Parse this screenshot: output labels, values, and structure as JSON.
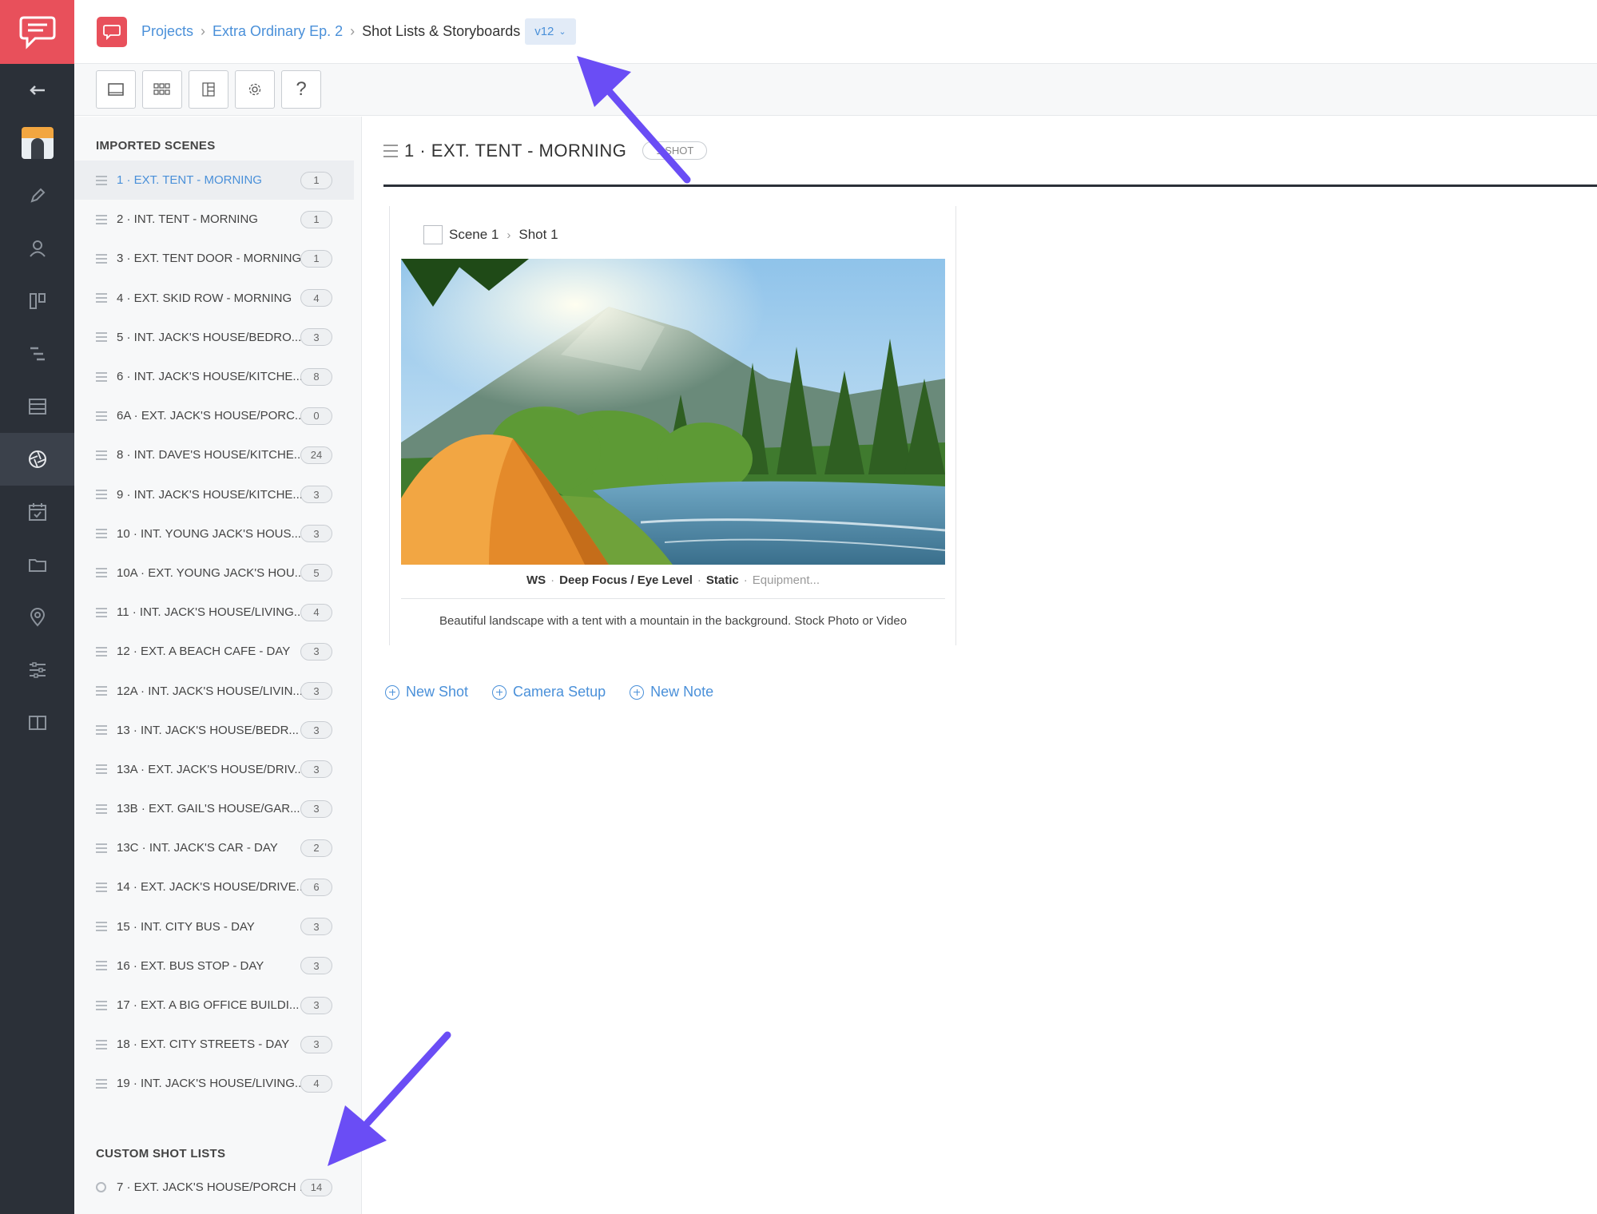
{
  "header": {
    "breadcrumbs": [
      "Projects",
      "Extra Ordinary Ep. 2"
    ],
    "current_page": "Shot Lists & Storyboards",
    "version": "v12"
  },
  "sidebar": {
    "imported_heading": "IMPORTED SCENES",
    "custom_heading": "CUSTOM SHOT LISTS",
    "scenes": [
      {
        "label": "1 · EXT. TENT - MORNING",
        "count": "1",
        "selected": true
      },
      {
        "label": "2 · INT. TENT - MORNING",
        "count": "1"
      },
      {
        "label": "3 · EXT. TENT DOOR - MORNING",
        "count": "1"
      },
      {
        "label": "4 · EXT. SKID ROW - MORNING",
        "count": "4"
      },
      {
        "label": "5 · INT. JACK'S HOUSE/BEDRO...",
        "count": "3"
      },
      {
        "label": "6 · INT. JACK'S HOUSE/KITCHE...",
        "count": "8"
      },
      {
        "label": "6A · EXT. JACK'S HOUSE/PORC...",
        "count": "0"
      },
      {
        "label": "8 · INT. DAVE'S HOUSE/KITCHE...",
        "count": "24"
      },
      {
        "label": "9 · INT. JACK'S HOUSE/KITCHE...",
        "count": "3"
      },
      {
        "label": "10 · INT. YOUNG JACK'S HOUS...",
        "count": "3"
      },
      {
        "label": "10A · EXT. YOUNG JACK'S HOU...",
        "count": "5"
      },
      {
        "label": "11 · INT. JACK'S HOUSE/LIVING...",
        "count": "4"
      },
      {
        "label": "12 · EXT. A BEACH CAFE - DAY",
        "count": "3"
      },
      {
        "label": "12A · INT. JACK'S HOUSE/LIVIN...",
        "count": "3"
      },
      {
        "label": "13 · INT. JACK'S HOUSE/BEDR...",
        "count": "3"
      },
      {
        "label": "13A · EXT. JACK'S HOUSE/DRIV...",
        "count": "3"
      },
      {
        "label": "13B · EXT. GAIL'S HOUSE/GAR...",
        "count": "3"
      },
      {
        "label": "13C · INT. JACK'S CAR - DAY",
        "count": "2"
      },
      {
        "label": "14 · EXT. JACK'S HOUSE/DRIVE...",
        "count": "6"
      },
      {
        "label": "15 · INT. CITY BUS - DAY",
        "count": "3"
      },
      {
        "label": "16 · EXT. BUS STOP - DAY",
        "count": "3"
      },
      {
        "label": "17 · EXT. A BIG OFFICE BUILDI...",
        "count": "3"
      },
      {
        "label": "18 · EXT. CITY STREETS - DAY",
        "count": "3"
      },
      {
        "label": "19 · INT. JACK'S HOUSE/LIVING...",
        "count": "4"
      }
    ],
    "custom": {
      "label": "7 · EXT. JACK'S HOUSE/PORCH ...",
      "count": "14"
    }
  },
  "main": {
    "scene_title": "1 · EXT. TENT - MORNING",
    "shot_count": "1 SHOT",
    "card": {
      "scene": "Scene 1",
      "shot": "Shot 1",
      "size": "WS",
      "focus": "Deep Focus / Eye Level",
      "movement": "Static",
      "equipment_placeholder": "Equipment...",
      "description": "Beautiful landscape with a tent with a mountain in the background. Stock Photo or Video"
    },
    "actions": {
      "new_shot": "New Shot",
      "camera_setup": "Camera Setup",
      "new_note": "New Note"
    }
  },
  "colors": {
    "brand": "#e8505b",
    "rail": "#2b3038",
    "link": "#4a90d9",
    "annotation_arrow": "#6a4df5"
  }
}
